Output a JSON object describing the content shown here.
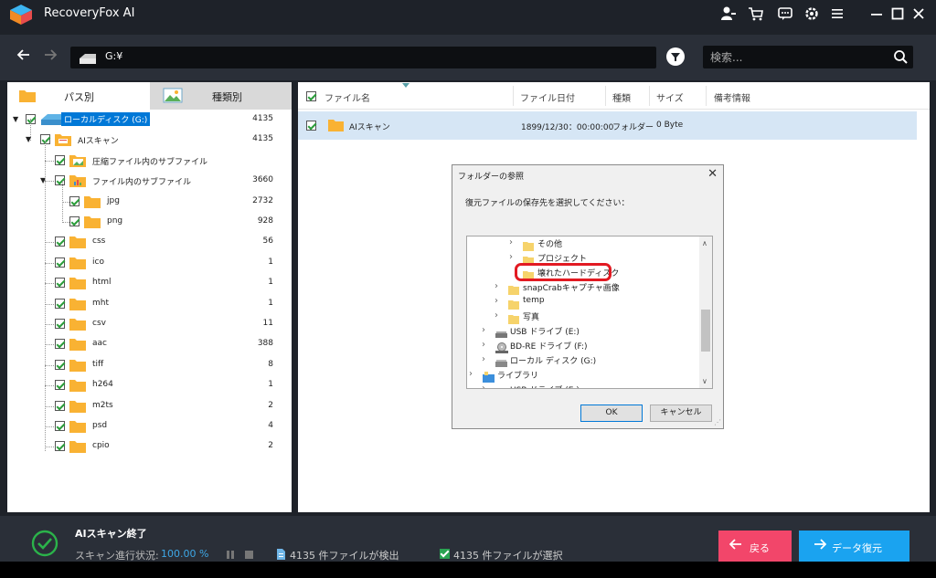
{
  "app": {
    "title": "RecoveryFox AI",
    "colors": {
      "title_bg": "#1e2229",
      "toolbar_bg": "#2a2f38",
      "accent_blue": "#1aa3f0",
      "accent_pink": "#f2466a",
      "check_green": "#2a9d3a",
      "selection_row": "#d6e6f5"
    }
  },
  "titlebar": {
    "icons": [
      "user-key-icon",
      "cart-icon",
      "chat-icon",
      "gear-icon",
      "menu-icon",
      "minimize-icon",
      "maximize-icon",
      "close-icon"
    ]
  },
  "addressbar": {
    "path": "G:¥",
    "search_placeholder": "検索..."
  },
  "left_panel": {
    "tabs": [
      {
        "label": "パス別",
        "active": true
      },
      {
        "label": "種類別",
        "active": false
      }
    ],
    "tree": [
      {
        "label": "ローカルディスク (G:)",
        "count": "4135",
        "level": 0,
        "icon": "drive-icon",
        "selected": true
      },
      {
        "label": "AIスキャン",
        "count": "4135",
        "level": 1,
        "icon": "scan-folder-icon"
      },
      {
        "label": "圧縮ファイル内のサブファイル",
        "count": "",
        "level": 2,
        "icon": "image-folder-icon"
      },
      {
        "label": "ファイル内のサブファイル",
        "count": "3660",
        "level": 2,
        "icon": "chart-folder-icon"
      },
      {
        "label": "jpg",
        "count": "2732",
        "level": 3,
        "icon": "folder-icon"
      },
      {
        "label": "png",
        "count": "928",
        "level": 3,
        "icon": "folder-icon"
      },
      {
        "label": "css",
        "count": "56",
        "level": 2,
        "icon": "folder-icon"
      },
      {
        "label": "ico",
        "count": "1",
        "level": 2,
        "icon": "folder-icon"
      },
      {
        "label": "html",
        "count": "1",
        "level": 2,
        "icon": "folder-icon"
      },
      {
        "label": "mht",
        "count": "1",
        "level": 2,
        "icon": "folder-icon"
      },
      {
        "label": "csv",
        "count": "11",
        "level": 2,
        "icon": "folder-icon"
      },
      {
        "label": "aac",
        "count": "388",
        "level": 2,
        "icon": "folder-icon"
      },
      {
        "label": "tiff",
        "count": "8",
        "level": 2,
        "icon": "folder-icon"
      },
      {
        "label": "h264",
        "count": "1",
        "level": 2,
        "icon": "folder-icon"
      },
      {
        "label": "m2ts",
        "count": "2",
        "level": 2,
        "icon": "folder-icon"
      },
      {
        "label": "psd",
        "count": "4",
        "level": 2,
        "icon": "folder-icon"
      },
      {
        "label": "cpio",
        "count": "2",
        "level": 2,
        "icon": "folder-icon"
      }
    ]
  },
  "table": {
    "columns": [
      "ファイル名",
      "ファイル日付",
      "種類",
      "サイズ",
      "備考情報"
    ],
    "rows": [
      {
        "name": "AIスキャン",
        "date": "1899/12/30：00:00:00",
        "type": "フォルダー",
        "size": "0 Byte",
        "note": ""
      }
    ]
  },
  "dialog": {
    "title": "フォルダーの参照",
    "message": "復元ファイルの保存先を選択してください：",
    "tree": [
      {
        "label": "その他",
        "icon": "folder-icon"
      },
      {
        "label": "プロジェクト",
        "icon": "folder-icon"
      },
      {
        "label": "壊れたハードディスク",
        "icon": "folder-icon",
        "highlighted": true
      },
      {
        "label": "snapCrabキャプチャ画像",
        "icon": "folder-icon"
      },
      {
        "label": "temp",
        "icon": "folder-icon"
      },
      {
        "label": "写真",
        "icon": "folder-icon"
      },
      {
        "label": "USB ドライブ (E:)",
        "icon": "usb-drive-icon"
      },
      {
        "label": "BD-RE ドライブ (F:)",
        "icon": "disc-drive-icon"
      },
      {
        "label": "ローカル ディスク (G:)",
        "icon": "hdd-icon"
      },
      {
        "label": "ライブラリ",
        "icon": "library-icon"
      },
      {
        "label": "USB ドライブ (E:)",
        "icon": "usb-drive-icon"
      }
    ],
    "ok_label": "OK",
    "cancel_label": "キャンセル"
  },
  "status": {
    "title": "AIスキャン終了",
    "progress_label": "スキャン進行状況:",
    "progress_value": "100.00 %",
    "detected": "4135 件ファイルが検出",
    "selected": "4135 件ファイルが選択",
    "back_label": "戻る",
    "recover_label": "データ復元"
  }
}
